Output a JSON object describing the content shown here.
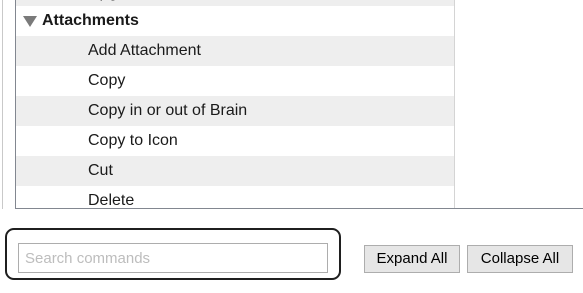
{
  "commands_tree": {
    "clipped_top_row": "Upgrade Services",
    "group": {
      "label": "Attachments",
      "expanded": true,
      "items": [
        {
          "label": "Add Attachment"
        },
        {
          "label": "Copy"
        },
        {
          "label": "Copy in or out of Brain"
        },
        {
          "label": "Copy to Icon"
        },
        {
          "label": "Cut"
        },
        {
          "label": "Delete"
        }
      ]
    }
  },
  "search": {
    "placeholder": "Search commands",
    "value": ""
  },
  "buttons": {
    "expand_all": "Expand All",
    "collapse_all": "Collapse All"
  }
}
